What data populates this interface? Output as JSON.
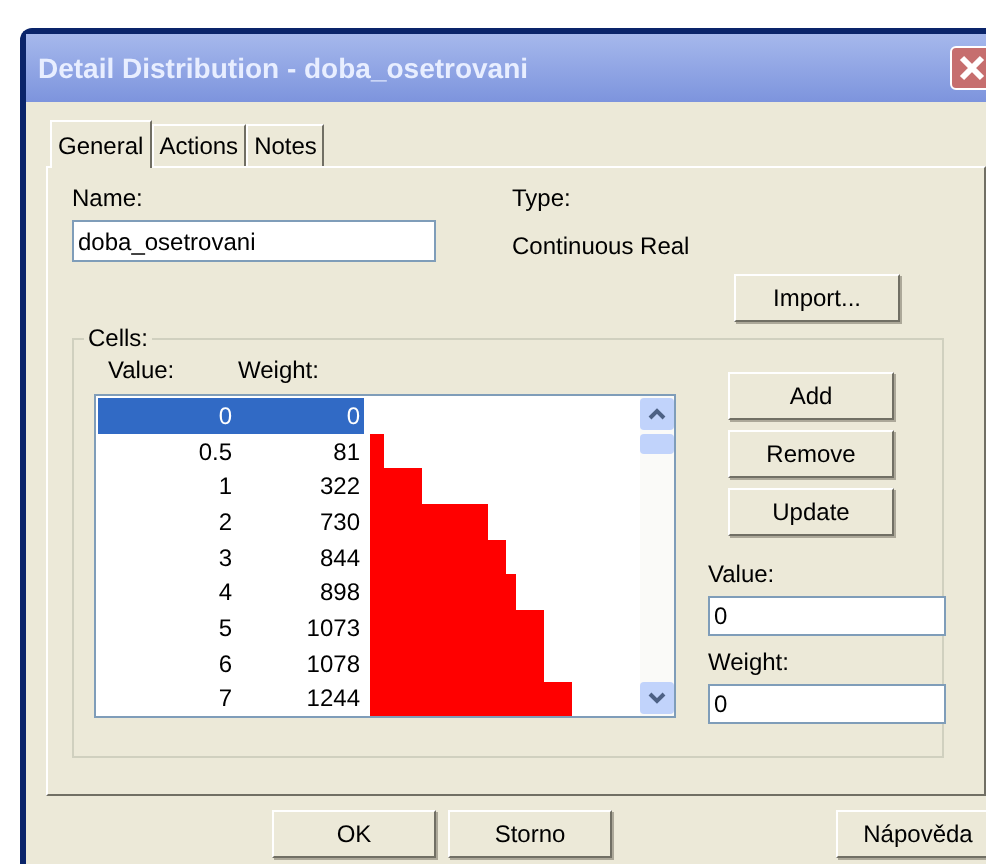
{
  "window": {
    "title": "Detail Distribution - doba_osetrovani"
  },
  "tabs": [
    {
      "label": "General",
      "selected": true
    },
    {
      "label": "Actions",
      "selected": false
    },
    {
      "label": "Notes",
      "selected": false
    }
  ],
  "name": {
    "label": "Name:",
    "value": "doba_osetrovani"
  },
  "type": {
    "label": "Type:",
    "value": "Continuous Real"
  },
  "import_button": "Import...",
  "cells": {
    "title": "Cells:",
    "value_header": "Value:",
    "weight_header": "Weight:",
    "rows": [
      {
        "value": "0",
        "weight": "0",
        "selected": true
      },
      {
        "value": "0.5",
        "weight": "81",
        "selected": false
      },
      {
        "value": "1",
        "weight": "322",
        "selected": false
      },
      {
        "value": "2",
        "weight": "730",
        "selected": false
      },
      {
        "value": "3",
        "weight": "844",
        "selected": false
      },
      {
        "value": "4",
        "weight": "898",
        "selected": false
      },
      {
        "value": "5",
        "weight": "1073",
        "selected": false
      },
      {
        "value": "6",
        "weight": "1078",
        "selected": false
      },
      {
        "value": "7",
        "weight": "1244",
        "selected": false
      }
    ],
    "buttons": [
      "Add",
      "Remove",
      "Update"
    ],
    "value_field": {
      "label": "Value:",
      "value": "0"
    },
    "weight_field": {
      "label": "Weight:",
      "value": "0"
    }
  },
  "footer_buttons": [
    "OK",
    "Storno",
    "Nápověda"
  ]
}
